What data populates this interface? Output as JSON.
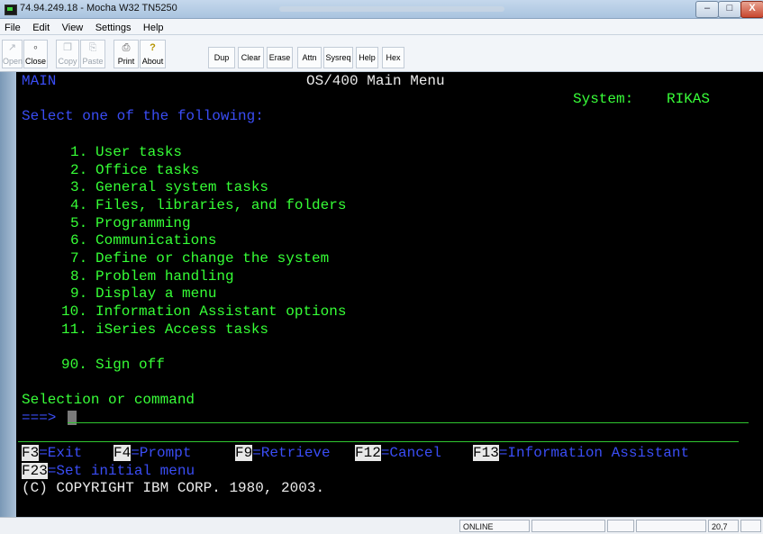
{
  "window": {
    "title": "74.94.249.18 - Mocha W32 TN5250",
    "minimize": "–",
    "maximize": "□",
    "close": "X"
  },
  "menu": [
    {
      "label": "File"
    },
    {
      "label": "Edit"
    },
    {
      "label": "View"
    },
    {
      "label": "Settings"
    },
    {
      "label": "Help"
    }
  ],
  "toolbar": {
    "open": {
      "label": "Open",
      "icon": "open-icon"
    },
    "close": {
      "label": "Close",
      "icon": "connect-icon"
    },
    "copy": {
      "label": "Copy",
      "icon": "copy-icon"
    },
    "paste": {
      "label": "Paste",
      "icon": "paste-icon"
    },
    "print": {
      "label": "Print",
      "icon": "printer-icon"
    },
    "about": {
      "label": "About",
      "icon": "question-icon"
    },
    "dup": "Dup",
    "clear": "Clear",
    "erase": "Erase",
    "attn": "Attn",
    "sysreq": "Sysreq",
    "help": "Help",
    "hex": "Hex"
  },
  "screen": {
    "menu_id": "MAIN",
    "title": "OS/400 Main Menu",
    "system_label": "System:",
    "system_name": "RIKAS",
    "instruction": "Select one of the following:",
    "options": [
      {
        "num": "1.",
        "text": "User tasks"
      },
      {
        "num": "2.",
        "text": "Office tasks"
      },
      {
        "num": "3.",
        "text": "General system tasks"
      },
      {
        "num": "4.",
        "text": "Files, libraries, and folders"
      },
      {
        "num": "5.",
        "text": "Programming"
      },
      {
        "num": "6.",
        "text": "Communications"
      },
      {
        "num": "7.",
        "text": "Define or change the system"
      },
      {
        "num": "8.",
        "text": "Problem handling"
      },
      {
        "num": "9.",
        "text": "Display a menu"
      },
      {
        "num": "10.",
        "text": "Information Assistant options"
      },
      {
        "num": "11.",
        "text": "iSeries Access tasks"
      }
    ],
    "signoff": {
      "num": "90.",
      "text": "Sign off"
    },
    "prompt_label": "Selection or command",
    "prompt_arrow": "===>",
    "input_value": "",
    "fkeys_row1": [
      {
        "key": "F3",
        "action": "=Exit"
      },
      {
        "key": "F4",
        "action": "=Prompt"
      },
      {
        "key": "F9",
        "action": "=Retrieve"
      },
      {
        "key": "F12",
        "action": "=Cancel"
      },
      {
        "key": "F13",
        "action": "=Information Assistant"
      }
    ],
    "fkeys_row2": [
      {
        "key": "F23",
        "action": "=Set initial menu"
      }
    ],
    "copyright": "(C) COPYRIGHT IBM CORP. 1980, 2003."
  },
  "status": {
    "connection": "ONLINE",
    "cursor_pos": "20,7"
  },
  "colors": {
    "screen_bg": "#000000",
    "green": "#39ff39",
    "blue": "#3a4df5",
    "white": "#ececec"
  }
}
